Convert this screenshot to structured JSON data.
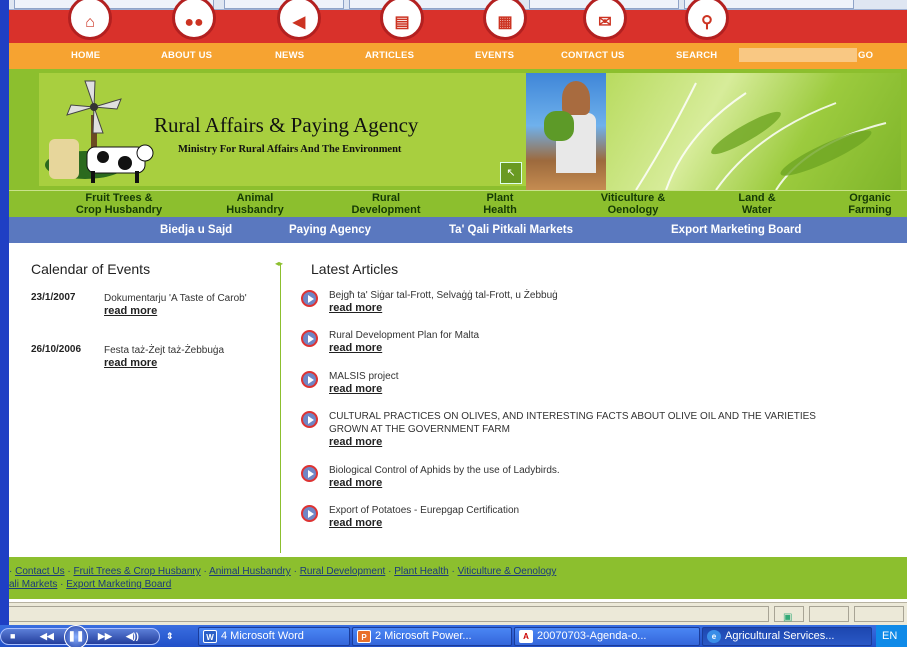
{
  "topnav": {
    "items": [
      "HOME",
      "ABOUT US",
      "NEWS",
      "ARTICLES",
      "EVENTS",
      "CONTACT US",
      "SEARCH"
    ],
    "go_label": "GO"
  },
  "banner": {
    "title": "Rural Affairs & Paying Agency",
    "subtitle": "Ministry For Rural Affairs And The Environment"
  },
  "categories": [
    {
      "line1": "Fruit Trees &",
      "line2": "Crop Husbandry"
    },
    {
      "line1": "Animal",
      "line2": "Husbandry"
    },
    {
      "line1": "Rural",
      "line2": "Development"
    },
    {
      "line1": "Plant",
      "line2": "Health"
    },
    {
      "line1": "Viticulture &",
      "line2": "Oenology"
    },
    {
      "line1": "Land &",
      "line2": "Water"
    },
    {
      "line1": "Organic",
      "line2": "Farming"
    }
  ],
  "subnav": [
    "Biedja u Sajd",
    "Paying Agency",
    "Ta' Qali Pitkali Markets",
    "Export Marketing Board"
  ],
  "events": {
    "heading": "Calendar of Events",
    "items": [
      {
        "date": "23/1/2007",
        "title": "Dokumentarju 'A Taste of Carob'",
        "link": "read more"
      },
      {
        "date": "26/10/2006",
        "title": "Festa taż-Żejt taż-Żebbuġa",
        "link": "read more"
      }
    ]
  },
  "articles": {
    "heading": "Latest Articles",
    "items": [
      {
        "title": "Bejgħ ta' Siġar tal-Frott, Selvaġġ tal-Frott, u Żebbuġ",
        "link": "read more"
      },
      {
        "title": "Rural Development Plan for Malta",
        "link": "read more"
      },
      {
        "title": "MALSIS project",
        "link": "read more"
      },
      {
        "title": "CULTURAL PRACTICES ON OLIVES, AND INTERESTING FACTS ABOUT OLIVE OIL AND THE VARIETIES GROWN AT THE GOVERNMENT FARM",
        "link": "read more"
      },
      {
        "title": "Biological Control of Aphids by the use of Ladybirds.",
        "link": "read more"
      },
      {
        "title": "Export of Potatoes - Eurepgap Certification",
        "link": "read more"
      }
    ]
  },
  "footer": {
    "line1": [
      " Contact Us",
      "Fruit Trees & Crop Husbanry",
      "Animal Husbandry",
      "Rural Development",
      "Plant Health",
      "Viticulture & Oenology"
    ],
    "line2": [
      "ali Markets",
      "Export Marketing Board"
    ],
    "sep": " · "
  },
  "taskbar": {
    "buttons": [
      "4 Microsoft Word",
      "2 Microsoft Power...",
      "20070703-Agenda-o...",
      "Agricultural Services..."
    ],
    "tray": "EN"
  },
  "colors": {
    "red_nav": "#d9312b",
    "orange_bar": "#f6a331",
    "green": "#8cbf2e",
    "blue_subnav": "#5a78bf",
    "desktop": "#1f3fc4"
  }
}
